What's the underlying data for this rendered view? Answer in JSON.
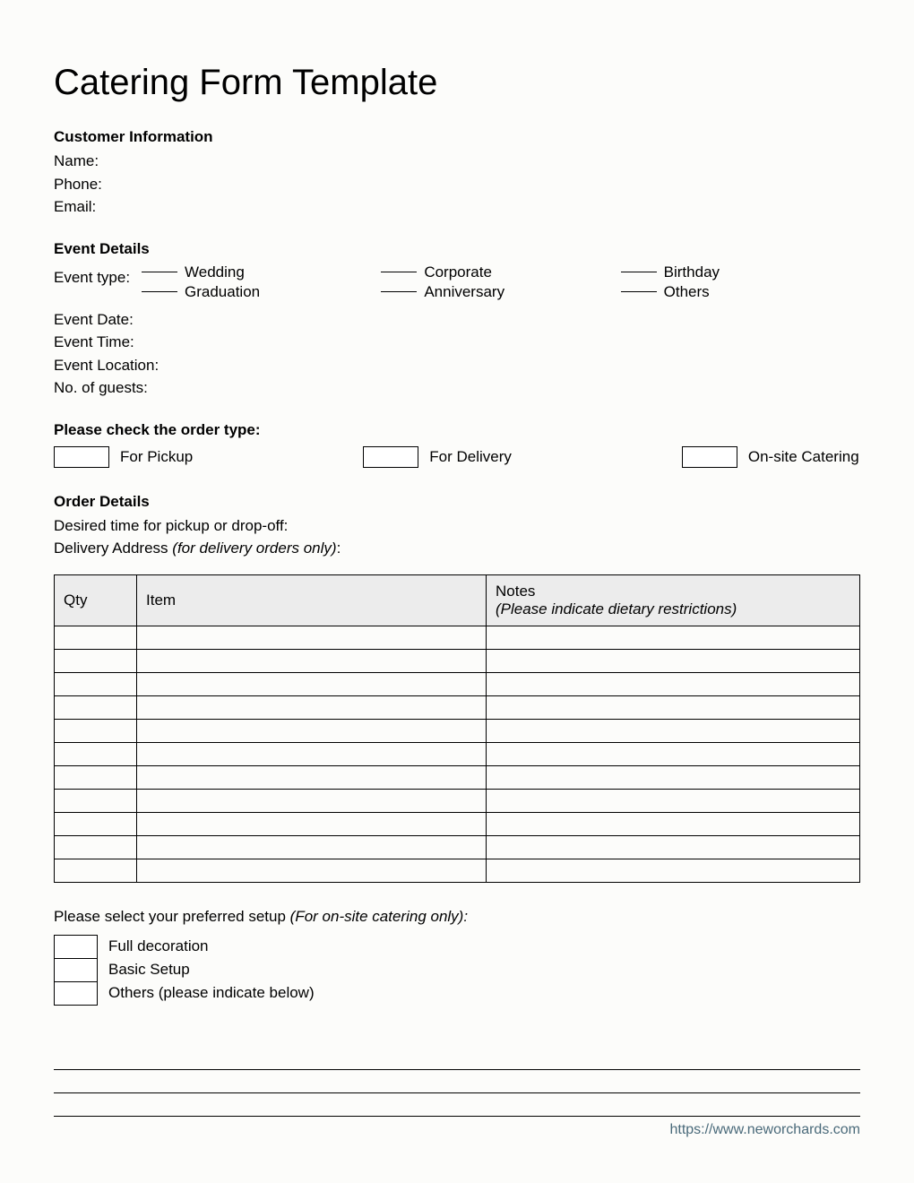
{
  "title": "Catering Form Template",
  "customer": {
    "header": "Customer Information",
    "name_label": "Name:",
    "phone_label": "Phone:",
    "email_label": "Email:"
  },
  "event": {
    "header": "Event Details",
    "type_label": "Event type:",
    "types": [
      "Wedding",
      "Corporate",
      "Birthday",
      "Graduation",
      "Anniversary",
      "Others"
    ],
    "date_label": "Event Date:",
    "time_label": "Event Time:",
    "location_label": "Event Location:",
    "guests_label": "No. of guests:"
  },
  "order_type": {
    "header": "Please check the order type:",
    "options": [
      "For Pickup",
      "For Delivery",
      "On-site Catering"
    ]
  },
  "order_details": {
    "header": "Order Details",
    "desired_time_label": "Desired time for pickup or drop-off:",
    "delivery_address_label": "Delivery Address ",
    "delivery_address_hint": "(for delivery orders only)",
    "table_headers": {
      "qty": "Qty",
      "item": "Item",
      "notes": "Notes",
      "notes_hint": "(Please indicate dietary restrictions)"
    },
    "row_count": 11
  },
  "setup": {
    "intro": "Please select your preferred setup ",
    "intro_hint": "(For on-site catering only):",
    "options": [
      "Full decoration",
      "Basic Setup",
      "Others (please indicate below)"
    ]
  },
  "footer_url": "https://www.neworchards.com"
}
